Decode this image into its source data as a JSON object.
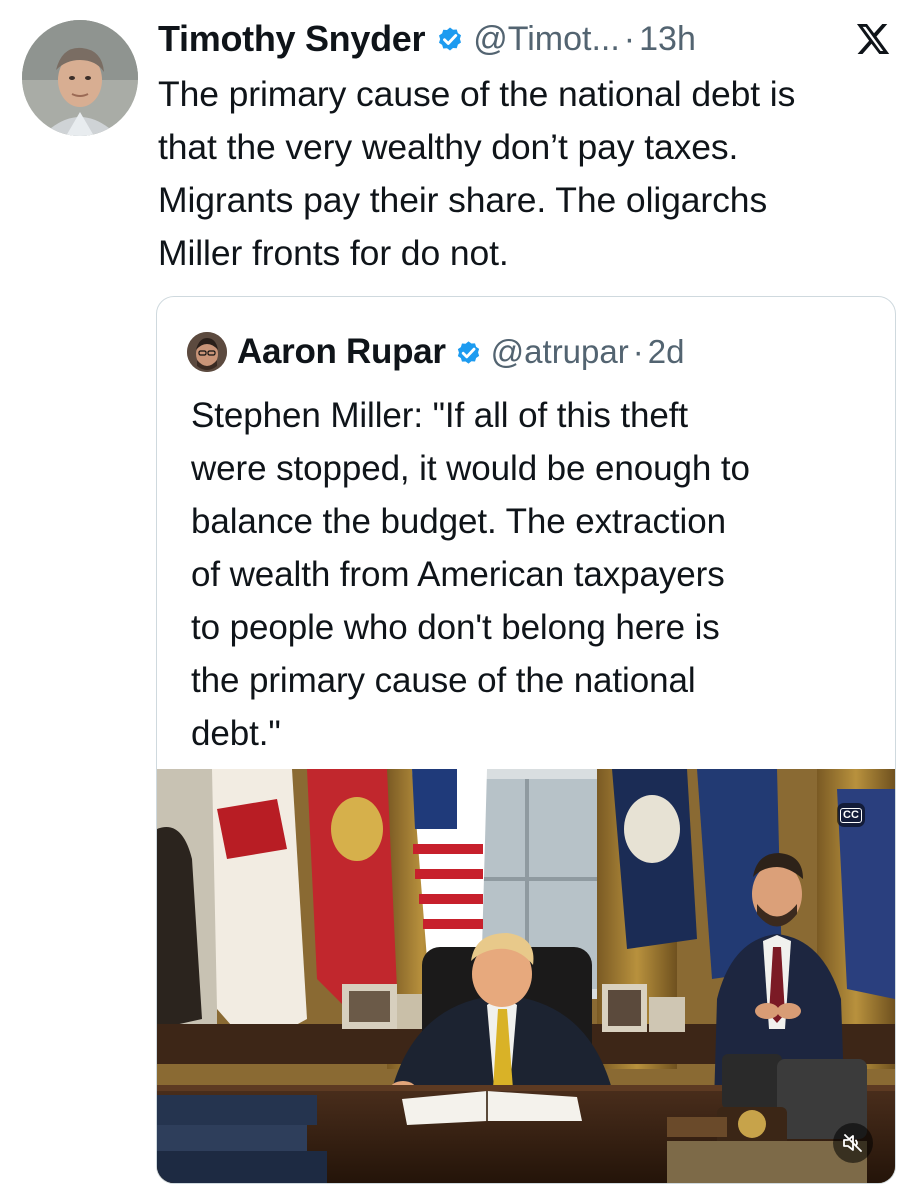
{
  "tweet": {
    "author_name": "Timothy Snyder",
    "handle": "@Timot...",
    "separator": "·",
    "time": "13h",
    "text": "The primary cause of the national debt is\nthat the very wealthy don’t pay taxes.\nMigrants pay their share. The oligarchs\nMiller fronts for do not.",
    "icons": {
      "verified": "verified-badge-icon",
      "platform": "x-logo-icon"
    }
  },
  "quote": {
    "author_name": "Aaron Rupar",
    "handle": "@atrupar",
    "separator": "·",
    "time": "2d",
    "text": "Stephen Miller: \"If all of this theft\nwere stopped, it would be enough to\nbalance the budget. The extraction\nof wealth from American taxpayers\nto people who don't belong here is\nthe primary cause of the national\ndebt.\"",
    "media": {
      "type": "video",
      "icons": [
        "closed-captions-icon",
        "muted-speaker-icon"
      ],
      "cc_label": "CC"
    }
  },
  "colors": {
    "verified_blue": "#1d9bf0",
    "secondary_text": "#536471",
    "border": "#cfd9de"
  }
}
